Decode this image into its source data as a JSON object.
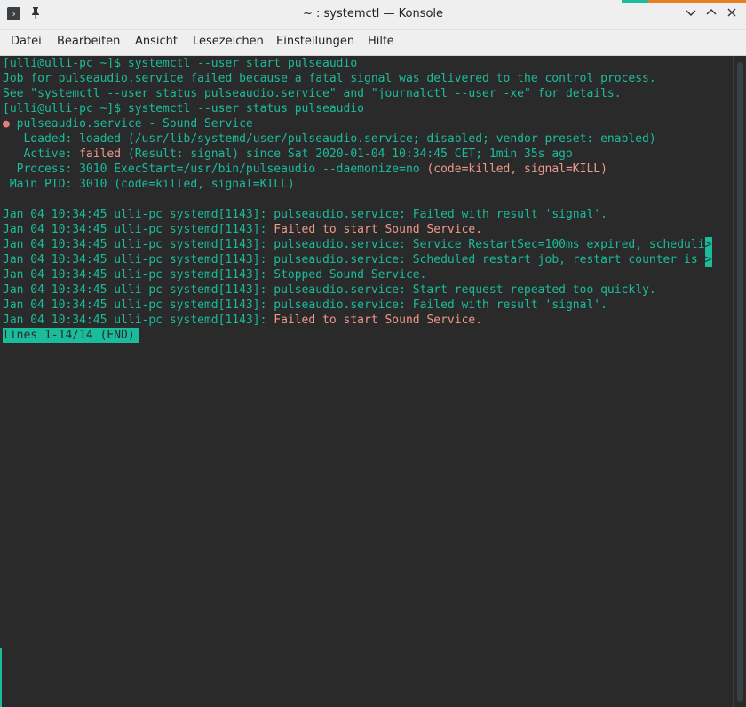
{
  "window": {
    "title": "~ : systemctl — Konsole",
    "accent_colors": [
      "#1abc9c",
      "#e67e22"
    ]
  },
  "titlebar": {
    "app_icon": "terminal-icon",
    "pin_icon": "pin-icon",
    "minimize_icon": "chevron-down-icon",
    "maximize_icon": "chevron-up-icon",
    "close_icon": "close-icon",
    "minimize_glyph": "﹀",
    "maximize_glyph": "︿",
    "close_glyph": "✕",
    "app_glyph": "›",
    "pin_glyph": "📌"
  },
  "menubar": {
    "items": [
      "Datei",
      "Bearbeiten",
      "Ansicht",
      "Lesezeichen",
      "Einstellungen",
      "Hilfe"
    ]
  },
  "terminal": {
    "prompt1": "[ulli@ulli-pc ~]$ systemctl --user start pulseaudio",
    "err1": "Job for pulseaudio.service failed because a fatal signal was delivered to the control process.",
    "err2": "See \"systemctl --user status pulseaudio.service\" and \"journalctl --user -xe\" for details.",
    "prompt2": "[ulli@ulli-pc ~]$ systemctl --user status pulseaudio",
    "svc_bullet": "●",
    "svc_name": " pulseaudio.service - Sound Service",
    "loaded": "   Loaded: loaded (/usr/lib/systemd/user/pulseaudio.service; disabled; vendor preset: enabled)",
    "active_label": "   Active: ",
    "active_state": "failed",
    "active_rest": " (Result: signal) since Sat 2020-01-04 10:34:45 CET; 1min 35s ago",
    "process_main": "  Process: 3010 ExecStart=/usr/bin/pulseaudio --daemonize=no ",
    "process_hl": "(code=killed, signal=KILL)",
    "mainpid": " Main PID: 3010 (code=killed, signal=KILL)",
    "log_prefix": "Jan 04 10:34:45 ulli-pc systemd[1143]: ",
    "log1": "pulseaudio.service: Failed with result 'signal'.",
    "log2": "Failed to start Sound Service.",
    "log3": "pulseaudio.service: Service RestartSec=100ms expired, scheduli",
    "log4": "pulseaudio.service: Scheduled restart job, restart counter is ",
    "log5": "Stopped Sound Service.",
    "log6": "pulseaudio.service: Start request repeated too quickly.",
    "log7": "pulseaudio.service: Failed with result 'signal'.",
    "log8": "Failed to start Sound Service.",
    "wrap_marker": ">",
    "status": "lines 1-14/14 (END)"
  }
}
